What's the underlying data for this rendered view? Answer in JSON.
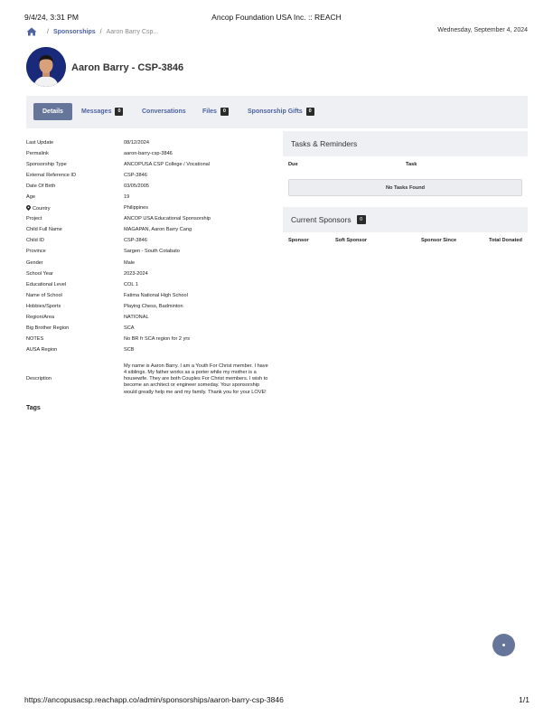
{
  "print_header": {
    "datetime": "9/4/24, 3:31 PM",
    "title": "Ancop Foundation USA Inc. :: REACH"
  },
  "breadcrumb": {
    "icon": "home-icon",
    "sponsorships": "Sponsorships",
    "current": "Aaron Barry Csp..."
  },
  "current_date": "Wednesday, September 4, 2024",
  "profile": {
    "name": "Aaron Barry - CSP-3846"
  },
  "tabs": [
    {
      "label": "Details",
      "count": ""
    },
    {
      "label": "Messages",
      "count": "0"
    },
    {
      "label": "Conversations",
      "count": ""
    },
    {
      "label": "Files",
      "count": "0"
    },
    {
      "label": "Sponsorship Gifts",
      "count": "0"
    }
  ],
  "details": [
    {
      "label": "Last Update",
      "value": "08/12/2024"
    },
    {
      "label": "Permalink",
      "value": "aaron-barry-csp-3846"
    },
    {
      "label": "Sponsorship Type",
      "value": "ANCOPUSA CSP College / Vocational"
    },
    {
      "label": "External Reference ID",
      "value": "CSP-3846"
    },
    {
      "label": "Date Of Birth",
      "value": "03/05/2005"
    },
    {
      "label": "Age",
      "value": "19"
    },
    {
      "label": "Country",
      "value": "Philippines"
    },
    {
      "label": "Project",
      "value": "ANCOP USA Educational Sponsorship"
    },
    {
      "label": "Child Full Name",
      "value": "MAGAPAN, Aaron Barry Cang"
    },
    {
      "label": "Child ID",
      "value": "CSP-3846"
    },
    {
      "label": "Province",
      "value": "Sargen - South Cotabato"
    },
    {
      "label": "Gender",
      "value": "Male"
    },
    {
      "label": "School Year",
      "value": "2023-2024"
    },
    {
      "label": "Educational Level",
      "value": "COL 1"
    },
    {
      "label": "Name of School",
      "value": "Fatima National High School"
    },
    {
      "label": "Hobbies/Sports",
      "value": "Playing Chess, Badminton"
    },
    {
      "label": "Region/Area",
      "value": "NATIONAL"
    },
    {
      "label": "Big Brother Region",
      "value": "SCA"
    },
    {
      "label": "NOTES",
      "value": "No BR fr SCA region for 2 yrs"
    },
    {
      "label": "AUSA Region",
      "value": "SCB"
    },
    {
      "label": "Description",
      "value": "My name is Aaron Barry.  I am a Youth For Christ member.  I have 4 siblings.  My father works as a porter while my mother is a housewife.  They are both Couples For Christ members.  I wish to become an architect or engineer someday. Your sponsorship would greatly help me and my family.  Thank you for your LOVE!"
    }
  ],
  "tags_heading": "Tags",
  "tasks": {
    "title": "Tasks & Reminders",
    "col_due": "Due",
    "col_task": "Task",
    "empty": "No Tasks Found"
  },
  "sponsors": {
    "title": "Current Sponsors",
    "count": "0",
    "col_sponsor": "Sponsor",
    "col_soft": "Soft Sponsor",
    "col_since": "Sponsor Since",
    "col_total": "Total Donated"
  },
  "print_footer": {
    "url": "https://ancopusacsp.reachapp.co/admin/sponsorships/aaron-barry-csp-3846",
    "page": "1/1"
  },
  "colors": {
    "accent": "#4d62a3",
    "tab_active": "#66769b",
    "panel_bg": "#eef0f3",
    "badge": "#2a2a2a"
  }
}
